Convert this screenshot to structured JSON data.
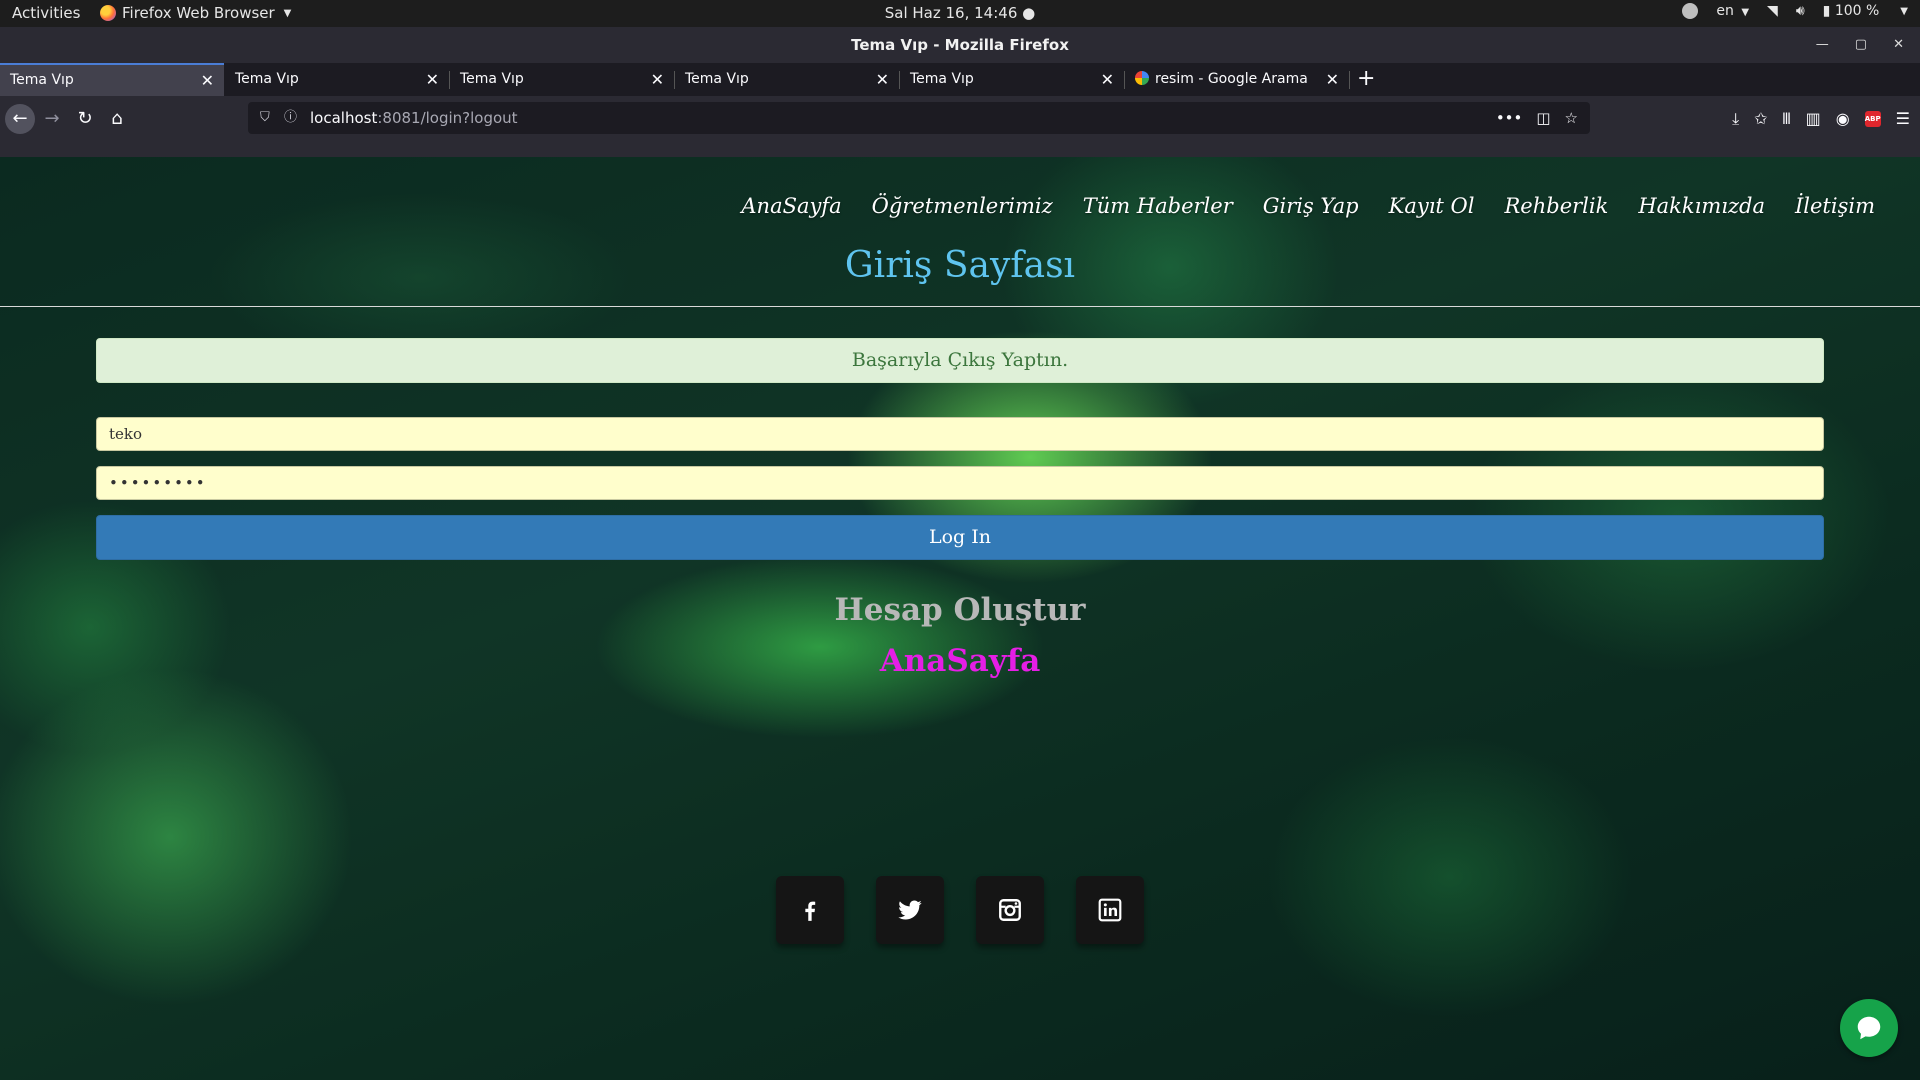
{
  "system_bar": {
    "activities": "Activities",
    "app_name": "Firefox Web Browser",
    "clock": "Sal Haz 16, 14:46",
    "language": "en",
    "battery": "100 %"
  },
  "window": {
    "title": "Tema Vıp - Mozilla Firefox"
  },
  "tabs": [
    {
      "label": "Tema Vıp",
      "active": true
    },
    {
      "label": "Tema Vıp",
      "active": false
    },
    {
      "label": "Tema Vıp",
      "active": false
    },
    {
      "label": "Tema Vıp",
      "active": false
    },
    {
      "label": "Tema Vıp",
      "active": false
    },
    {
      "label": "resim - Google Arama",
      "active": false
    }
  ],
  "address_bar": {
    "host": "localhost",
    "rest": ":8081/login?logout"
  },
  "site_nav": [
    "AnaSayfa",
    "Öğretmenlerimiz",
    "Tüm Haberler",
    "Giriş Yap",
    "Kayıt Ol",
    "Rehberlik",
    "Hakkımızda",
    "İletişim"
  ],
  "page": {
    "title": "Giriş Sayfası",
    "alert": "Başarıyla Çıkış Yaptın.",
    "username_value": "teko",
    "password_mask": "•••••••••",
    "login_button": "Log In",
    "create_account": "Hesap Oluştur",
    "home_link": "AnaSayfa"
  },
  "social_icons": [
    "facebook-icon",
    "twitter-icon",
    "instagram-icon",
    "linkedin-icon"
  ],
  "colors": {
    "title_blue": "#5fc4ef",
    "alert_bg": "#dff0d8",
    "alert_text": "#3c763d",
    "input_bg": "#fffecc",
    "button_blue": "#337ab7",
    "home_link_magenta": "#e51ee5",
    "chat_green": "#16a34a"
  }
}
